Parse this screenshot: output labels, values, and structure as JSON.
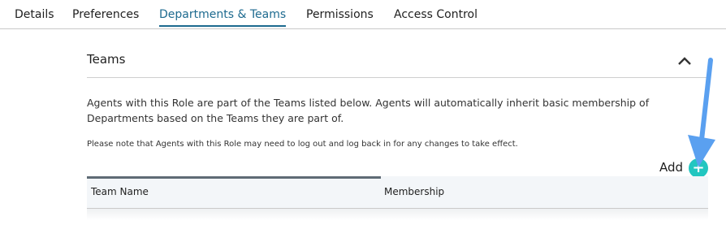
{
  "tabs": [
    {
      "label": "Details"
    },
    {
      "label": "Preferences"
    },
    {
      "label": "Departments & Teams"
    },
    {
      "label": "Permissions"
    },
    {
      "label": "Access Control"
    }
  ],
  "section": {
    "title": "Teams",
    "description": "Agents with this Role are part of the Teams listed below. Agents will automatically inherit basic membership of Departments based on the Teams they are part of.",
    "note": "Please note that Agents with this Role may need to log out and log back in for any changes to take effect."
  },
  "add": {
    "label": "Add",
    "icon": "+"
  },
  "table": {
    "columns": [
      "Team Name",
      "Membership"
    ]
  },
  "colors": {
    "accent": "#1d6a8f",
    "add_button": "#22c6c0",
    "annotation_arrow": "#5aa0f0"
  }
}
